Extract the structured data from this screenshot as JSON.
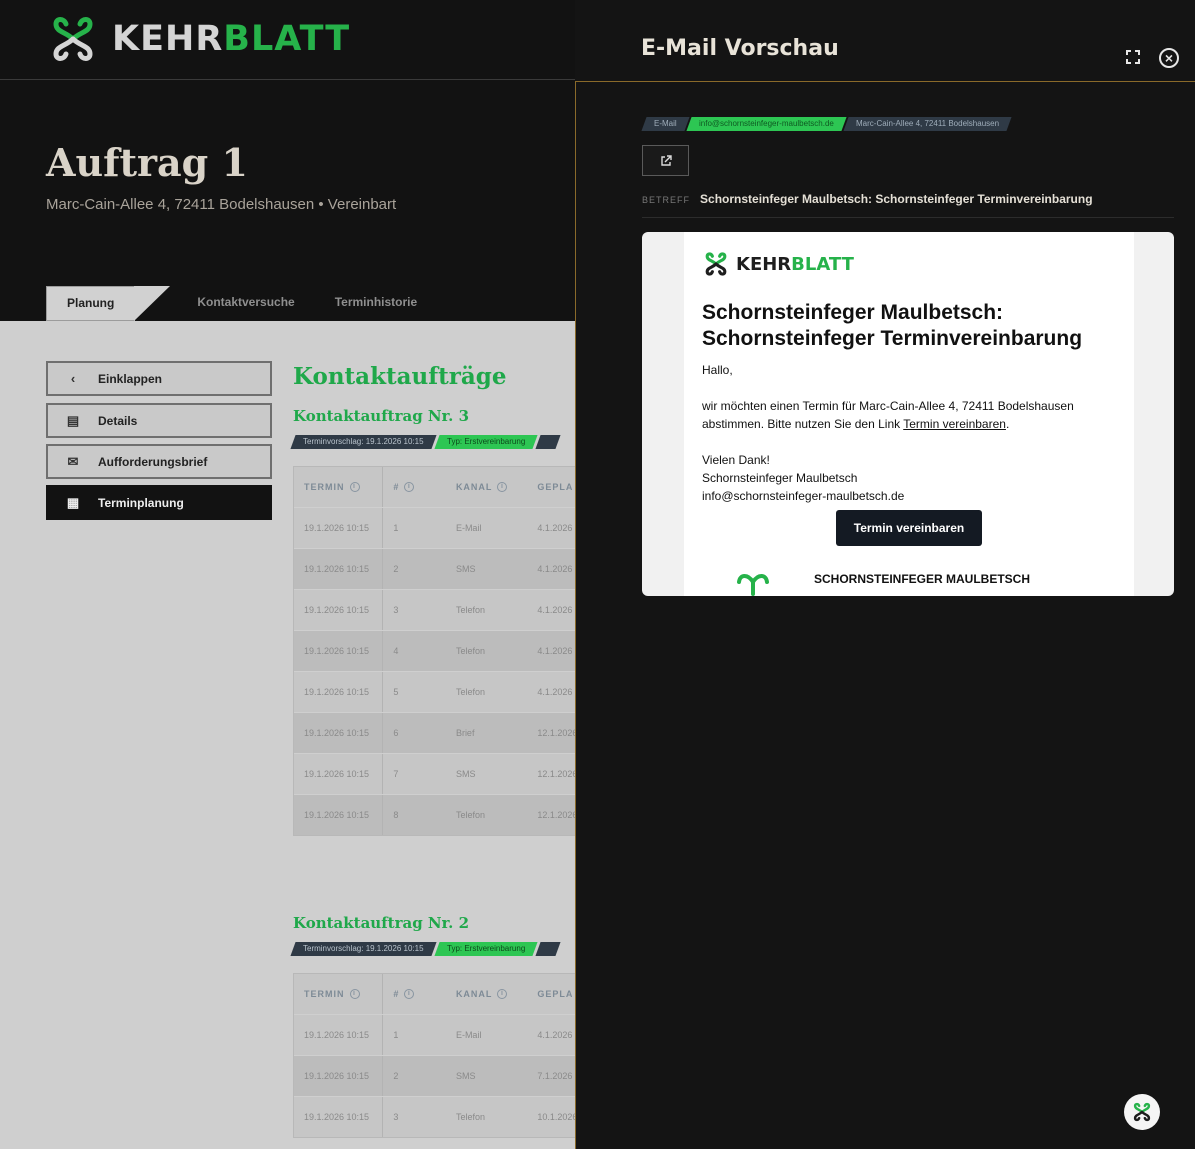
{
  "app": {
    "logo_primary": "KEHR",
    "logo_accent": "BLATT",
    "brand_green": "#26b24a"
  },
  "order": {
    "title": "Auftrag 1",
    "subtitle": "Marc-Cain-Allee 4, 72411 Bodelshausen • Vereinbart"
  },
  "tabs": [
    {
      "label": "Planung"
    },
    {
      "label": "Kontaktversuche"
    },
    {
      "label": "Terminhistorie"
    }
  ],
  "sidebar": {
    "items": [
      {
        "label": "Einklappen"
      },
      {
        "label": "Details"
      },
      {
        "label": "Aufforderungsbrief"
      },
      {
        "label": "Terminplanung"
      }
    ]
  },
  "main": {
    "heading": "Kontaktaufträge",
    "sections": [
      {
        "title": "Kontaktauftrag Nr. 3",
        "tags": [
          "Terminvorschlag: 19.1.2026 10:15",
          "Typ: Erstvereinbarung"
        ],
        "columns": [
          "TERMIN",
          "#",
          "KANAL",
          "GEPLA"
        ],
        "rows": [
          [
            "19.1.2026 10:15",
            "1",
            "E-Mail",
            "4.1.2026"
          ],
          [
            "19.1.2026 10:15",
            "2",
            "SMS",
            "4.1.2026"
          ],
          [
            "19.1.2026 10:15",
            "3",
            "Telefon",
            "4.1.2026"
          ],
          [
            "19.1.2026 10:15",
            "4",
            "Telefon",
            "4.1.2026"
          ],
          [
            "19.1.2026 10:15",
            "5",
            "Telefon",
            "4.1.2026"
          ],
          [
            "19.1.2026 10:15",
            "6",
            "Brief",
            "12.1.2026"
          ],
          [
            "19.1.2026 10:15",
            "7",
            "SMS",
            "12.1.2026"
          ],
          [
            "19.1.2026 10:15",
            "8",
            "Telefon",
            "12.1.2026"
          ]
        ]
      },
      {
        "title": "Kontaktauftrag Nr. 2",
        "tags": [
          "Terminvorschlag: 19.1.2026 10:15",
          "Typ: Erstvereinbarung"
        ],
        "columns": [
          "TERMIN",
          "#",
          "KANAL",
          "GEPLA"
        ],
        "rows": [
          [
            "19.1.2026 10:15",
            "1",
            "E-Mail",
            "4.1.2026"
          ],
          [
            "19.1.2026 10:15",
            "2",
            "SMS",
            "7.1.2026"
          ],
          [
            "19.1.2026 10:15",
            "3",
            "Telefon",
            "10.1.2026"
          ]
        ]
      }
    ]
  },
  "drawer": {
    "title": "E-Mail Vorschau",
    "tags": [
      "E-Mail",
      "info@schornsteinfeger-maulbetsch.de",
      "Marc-Cain-Allee 4, 72411 Bodelshausen"
    ],
    "subject_label": "BETREFF",
    "subject": "Schornsteinfeger Maulbetsch: Schornsteinfeger Terminvereinbarung",
    "email": {
      "heading": "Schornsteinfeger Maulbetsch: Schornsteinfeger Terminvereinbarung",
      "greeting": "Hallo,",
      "body_before_link": "wir möchten einen Termin für Marc-Cain-Allee 4, 72411 Bodelshausen abstimmen. Bitte nutzen Sie den Link ",
      "link_text": "Termin vereinbaren",
      "body_after_link": ".",
      "sign_thanks": "Vielen Dank!",
      "sign_company": "Schornsteinfeger Maulbetsch",
      "sign_email": "info@schornsteinfeger-maulbetsch.de",
      "button": "Termin vereinbaren",
      "footer_company": "SCHORNSTEINFEGER MAULBETSCH"
    }
  }
}
